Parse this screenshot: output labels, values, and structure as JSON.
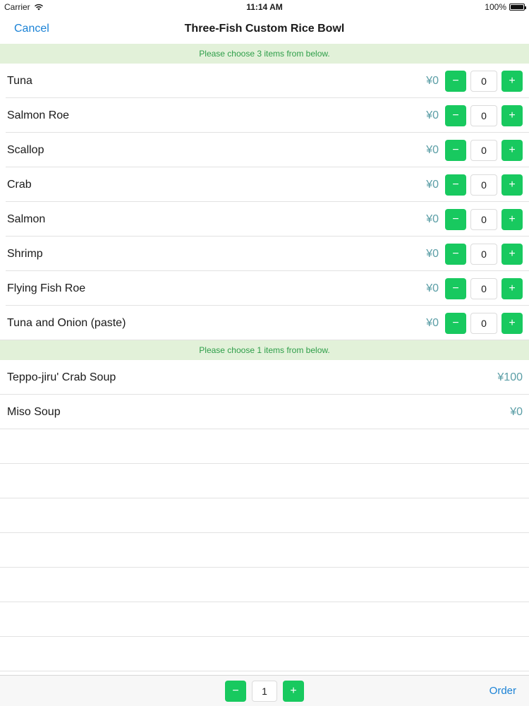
{
  "status_bar": {
    "carrier": "Carrier",
    "time": "11:14 AM",
    "battery": "100%",
    "battery_level": 1.0
  },
  "nav": {
    "cancel_label": "Cancel",
    "title": "Three-Fish Custom Rice Bowl"
  },
  "section1": {
    "header": "Please choose 3 items from below.",
    "items": [
      {
        "name": "Tuna",
        "price": "¥0",
        "qty": "0"
      },
      {
        "name": "Salmon Roe",
        "price": "¥0",
        "qty": "0"
      },
      {
        "name": "Scallop",
        "price": "¥0",
        "qty": "0"
      },
      {
        "name": "Crab",
        "price": "¥0",
        "qty": "0"
      },
      {
        "name": "Salmon",
        "price": "¥0",
        "qty": "0"
      },
      {
        "name": "Shrimp",
        "price": "¥0",
        "qty": "0"
      },
      {
        "name": "Flying Fish Roe",
        "price": "¥0",
        "qty": "0"
      },
      {
        "name": "Tuna and Onion (paste)",
        "price": "¥0",
        "qty": "0"
      }
    ]
  },
  "section2": {
    "header": "Please choose 1 items from below.",
    "items": [
      {
        "name": "Teppo-jiru' Crab Soup",
        "price": "¥100"
      },
      {
        "name": "Miso Soup",
        "price": "¥0"
      }
    ]
  },
  "stepper": {
    "minus": "−",
    "plus": "+"
  },
  "bottom": {
    "qty": "1",
    "order_label": "Order"
  },
  "colors": {
    "accent_blue": "#1a82d6",
    "button_green": "#18c95f",
    "header_bg": "#e2f1d9",
    "header_text": "#2e9e49",
    "price_text": "#5b9ea6"
  },
  "icons": {
    "wifi": "wifi-icon",
    "battery": "battery-icon"
  }
}
